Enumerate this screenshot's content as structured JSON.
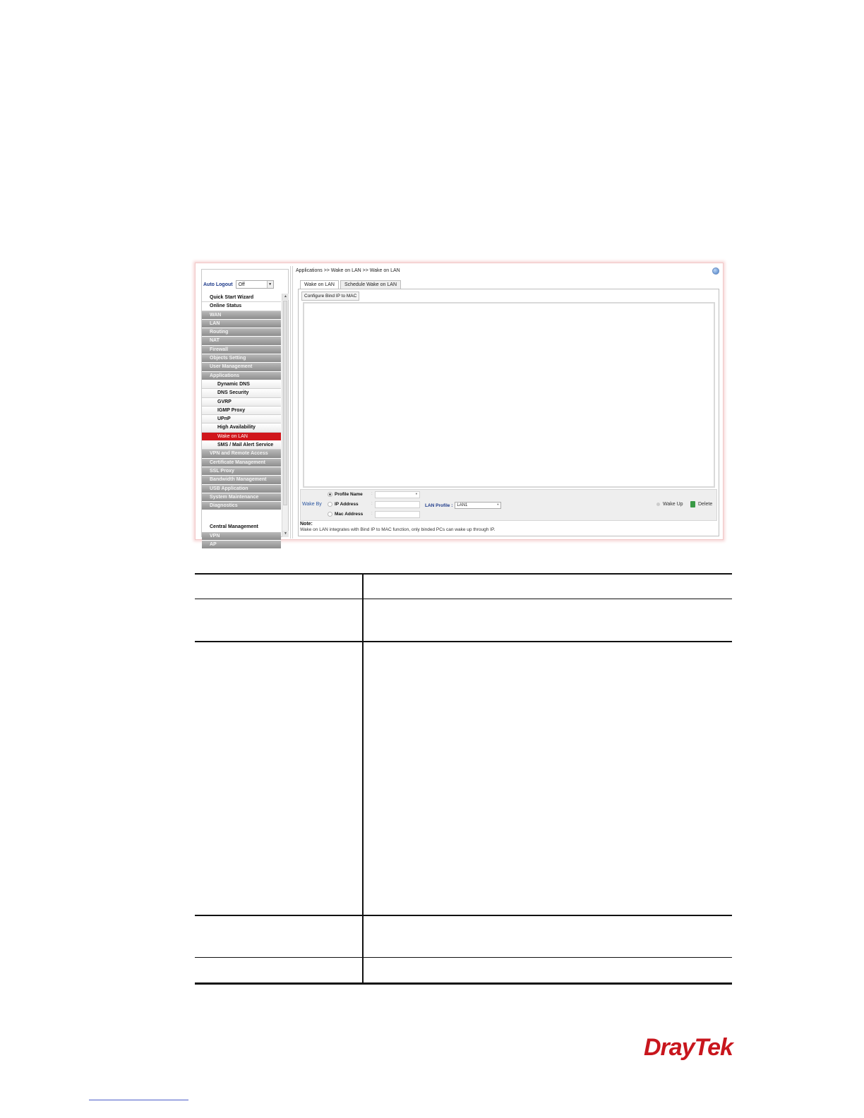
{
  "screenshot": {
    "breadcrumb": "Applications >> Wake on LAN >> Wake on LAN",
    "auto_logout": {
      "label": "Auto Logout",
      "value": "Off"
    },
    "menu": [
      {
        "label": "Quick Start Wizard",
        "style": "white"
      },
      {
        "label": "Online Status",
        "style": "white"
      },
      {
        "label": "WAN",
        "style": "gray"
      },
      {
        "label": "LAN",
        "style": "gray"
      },
      {
        "label": "Routing",
        "style": "gray"
      },
      {
        "label": "NAT",
        "style": "gray"
      },
      {
        "label": "Firewall",
        "style": "gray"
      },
      {
        "label": "Objects Setting",
        "style": "gray"
      },
      {
        "label": "User Management",
        "style": "gray"
      },
      {
        "label": "Applications",
        "style": "gray"
      },
      {
        "label": "Dynamic DNS",
        "style": "sub"
      },
      {
        "label": "DNS Security",
        "style": "sub"
      },
      {
        "label": "GVRP",
        "style": "sub"
      },
      {
        "label": "IGMP Proxy",
        "style": "sub"
      },
      {
        "label": "UPnP",
        "style": "sub"
      },
      {
        "label": "High Availability",
        "style": "sub"
      },
      {
        "label": "Wake on LAN",
        "style": "active"
      },
      {
        "label": "SMS / Mail Alert Service",
        "style": "sub"
      },
      {
        "label": "VPN and Remote Access",
        "style": "gray"
      },
      {
        "label": "Certificate Management",
        "style": "gray"
      },
      {
        "label": "SSL Proxy",
        "style": "gray"
      },
      {
        "label": "Bandwidth Management",
        "style": "gray"
      },
      {
        "label": "USB Application",
        "style": "gray"
      },
      {
        "label": "System Maintenance",
        "style": "gray"
      },
      {
        "label": "Diagnostics",
        "style": "gray"
      },
      {
        "label": "",
        "style": "gap"
      },
      {
        "label": "Central Management",
        "style": "white2"
      },
      {
        "label": "VPN",
        "style": "gray"
      },
      {
        "label": "AP",
        "style": "gray"
      }
    ],
    "tabs": [
      "Wake on LAN",
      "Schedule Wake on LAN"
    ],
    "subtab": "Configure Bind IP to MAC",
    "wake_by_label": "Wake By",
    "options": [
      "Profile Name",
      "IP Address",
      "Mac Address"
    ],
    "lan_profile": {
      "label": "LAN Profile :",
      "value": "LAN1"
    },
    "wake_up_label": "Wake Up",
    "delete_label": "Delete",
    "note_title": "Note:",
    "note_text": "Wake on LAN integrates with Bind IP to MAC function, only binded PCs can wake up through IP."
  },
  "brand": "DrayTek"
}
